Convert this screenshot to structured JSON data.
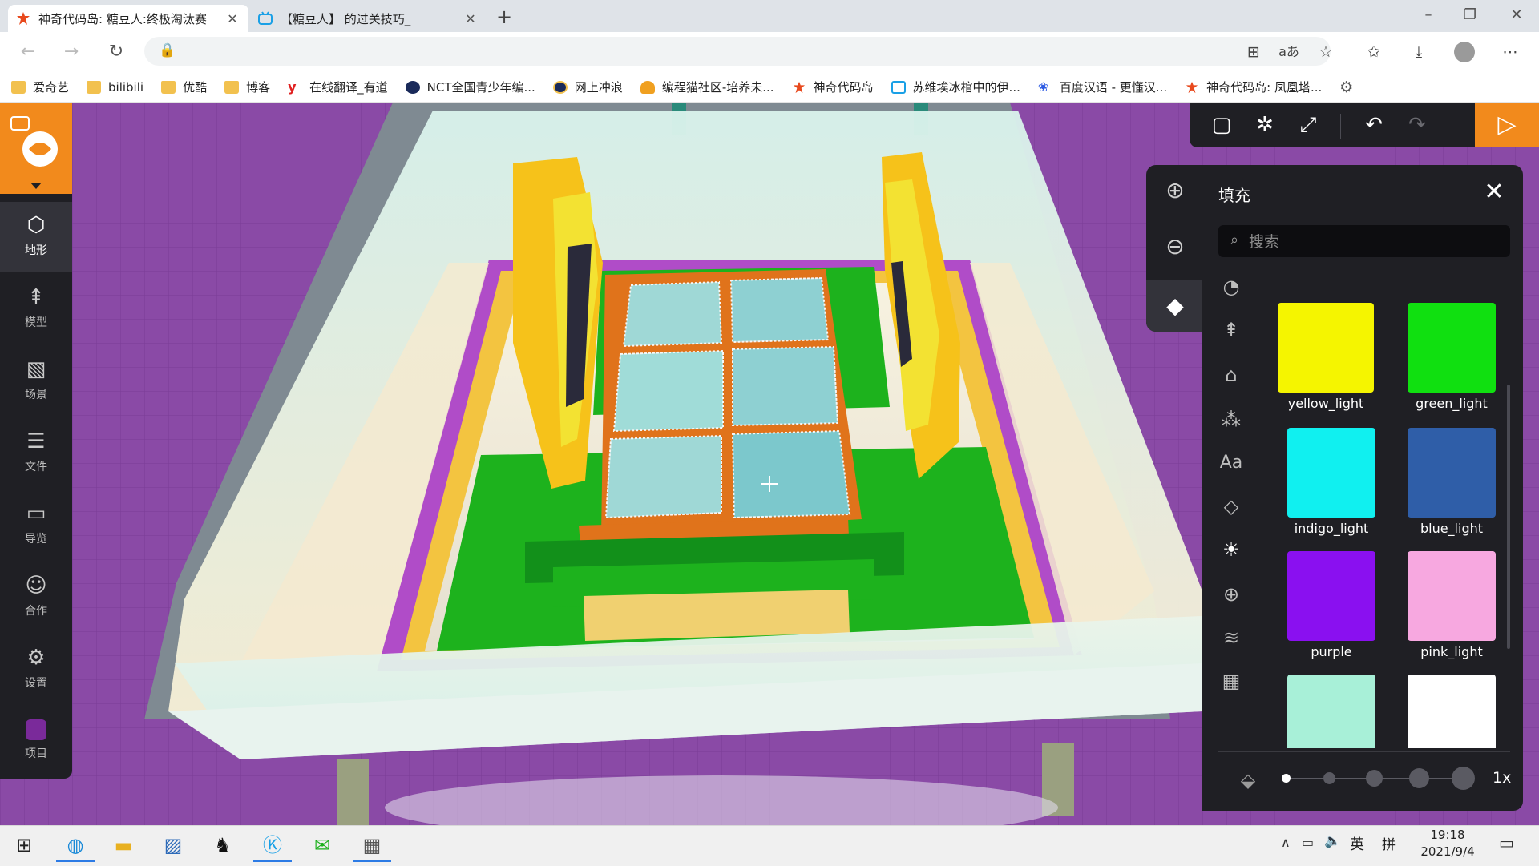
{
  "browser": {
    "tabs": [
      {
        "title": "神奇代码岛: 糖豆人:终极淘汰赛",
        "active": true
      },
      {
        "title": "【糖豆人】 的过关技巧_",
        "active": false
      }
    ],
    "address": "",
    "bookmarks": [
      {
        "label": "爱奇艺",
        "icon": "folder-icon"
      },
      {
        "label": "bilibili",
        "icon": "folder-icon"
      },
      {
        "label": "优酷",
        "icon": "folder-icon"
      },
      {
        "label": "博客",
        "icon": "folder-icon"
      },
      {
        "label": "在线翻译_有道",
        "icon": "youdao-icon"
      },
      {
        "label": "NCT全国青少年编...",
        "icon": "nct-icon"
      },
      {
        "label": "网上冲浪",
        "icon": "globe-icon"
      },
      {
        "label": "编程猫社区-培养未...",
        "icon": "codemao-icon"
      },
      {
        "label": "神奇代码岛",
        "icon": "dao3-icon"
      },
      {
        "label": "苏维埃冰棺中的伊...",
        "icon": "bilibili-icon"
      },
      {
        "label": "百度汉语 - 更懂汉...",
        "icon": "baidu-icon"
      },
      {
        "label": "神奇代码岛: 凤凰塔...",
        "icon": "dao3-icon"
      }
    ]
  },
  "sidebar": {
    "items": [
      {
        "label": "地形",
        "icon": "cube-icon",
        "active": true
      },
      {
        "label": "模型",
        "icon": "tree-icon",
        "active": false
      },
      {
        "label": "场景",
        "icon": "image-icon",
        "active": false
      },
      {
        "label": "文件",
        "icon": "file-icon",
        "active": false
      },
      {
        "label": "导览",
        "icon": "folder-icon",
        "active": false
      },
      {
        "label": "合作",
        "icon": "users-icon",
        "active": false
      },
      {
        "label": "设置",
        "icon": "gear-icon",
        "active": false
      },
      {
        "label": "项目",
        "icon": "project-icon",
        "active": false
      }
    ]
  },
  "panel": {
    "title": "填充",
    "search_placeholder": "搜索",
    "blocks": [
      {
        "name": "yellow_light",
        "color": "#f5f500"
      },
      {
        "name": "green_light",
        "color": "#10e010"
      },
      {
        "name": "indigo_light",
        "color": "#10f0f0"
      },
      {
        "name": "blue_light",
        "color": "#2f5ea8"
      },
      {
        "name": "purple",
        "color": "#8a10f0"
      },
      {
        "name": "pink_light",
        "color": "#f7a8e0"
      },
      {
        "name": "",
        "color": "#a8f0d8"
      },
      {
        "name": "",
        "color": "#ffffff"
      }
    ],
    "speed": "1x"
  },
  "taskbar": {
    "time": "19:18",
    "date": "2021/9/4",
    "ime": "英",
    "ime2": "拼"
  },
  "accent": "#f28a1c"
}
